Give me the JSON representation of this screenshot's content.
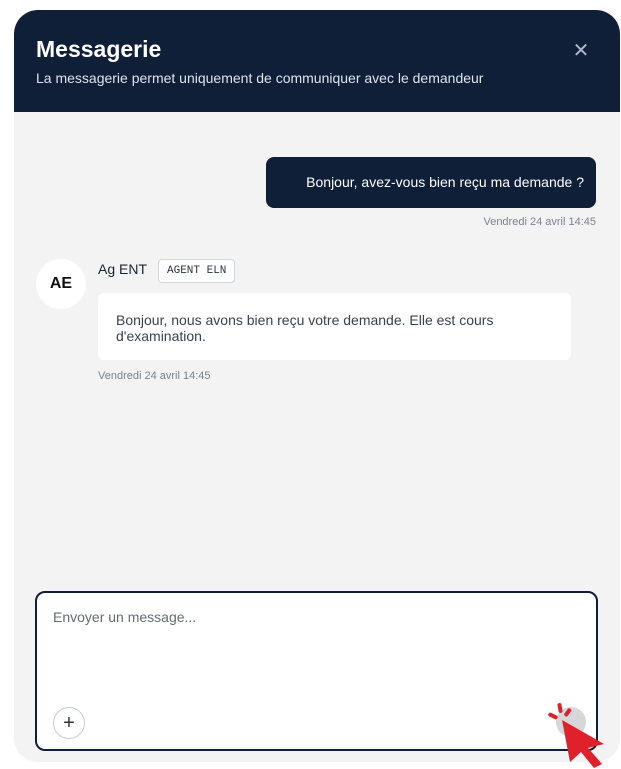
{
  "header": {
    "title": "Messagerie",
    "subtitle": "La messagerie permet uniquement de communiquer avec le demandeur",
    "close_icon": "close-icon",
    "background": "#0f1f38"
  },
  "messages": [
    {
      "direction": "outgoing",
      "text": "Bonjour, avez-vous bien reçu ma demande ?",
      "timestamp": "Vendredi 24 avril 14:45"
    },
    {
      "direction": "incoming",
      "avatar_initials": "AE",
      "sender": "Ag ENT",
      "role_badge": "AGENT ELN",
      "text": "Bonjour, nous avons bien reçu votre demande. Elle est cours d'examination.",
      "timestamp": "Vendredi 24 avril 14:45"
    }
  ],
  "composer": {
    "placeholder": "Envoyer un message...",
    "value": "",
    "add_icon": "plus-icon",
    "send_icon": "send-icon"
  },
  "colors": {
    "panel_bg": "#f3f3f4",
    "accent": "#0f1f38",
    "pointer": "#e0202a"
  }
}
